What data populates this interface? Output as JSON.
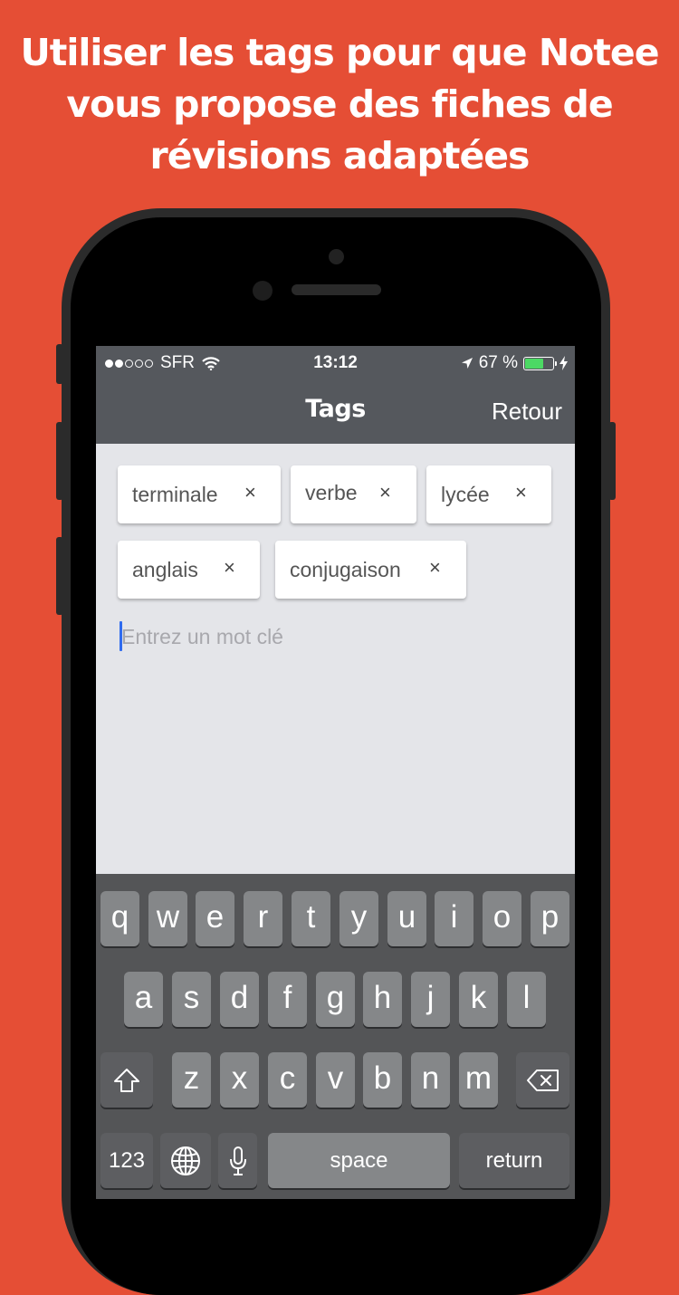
{
  "headline": [
    "Utiliser les tags pour que Notee",
    "vous propose des fiches de",
    "révisions adaptées"
  ],
  "status": {
    "carrier": "SFR",
    "time": "13:12",
    "battery_text": "67 %",
    "battery_level": 0.67
  },
  "navbar": {
    "title": "Tags",
    "back_label": "Retour"
  },
  "tags": [
    {
      "label": "terminale",
      "remove": "×"
    },
    {
      "label": "verbe",
      "remove": "×"
    },
    {
      "label": "lycée",
      "remove": "×"
    },
    {
      "label": "anglais",
      "remove": "×"
    },
    {
      "label": "conjugaison",
      "remove": "×"
    }
  ],
  "input": {
    "placeholder": "Entrez un mot clé",
    "value": ""
  },
  "keyboard": {
    "row1": [
      "q",
      "w",
      "e",
      "r",
      "t",
      "y",
      "u",
      "i",
      "o",
      "p"
    ],
    "row2": [
      "a",
      "s",
      "d",
      "f",
      "g",
      "h",
      "j",
      "k",
      "l"
    ],
    "row3": [
      "z",
      "x",
      "c",
      "v",
      "b",
      "n",
      "m"
    ],
    "numbers": "123",
    "space": "space",
    "return": "return"
  },
  "colors": {
    "background": "#E54E35",
    "bar": "#55585D",
    "screen": "#E4E5E9",
    "battery": "#4CD964",
    "cursor": "#2F6BEF"
  }
}
